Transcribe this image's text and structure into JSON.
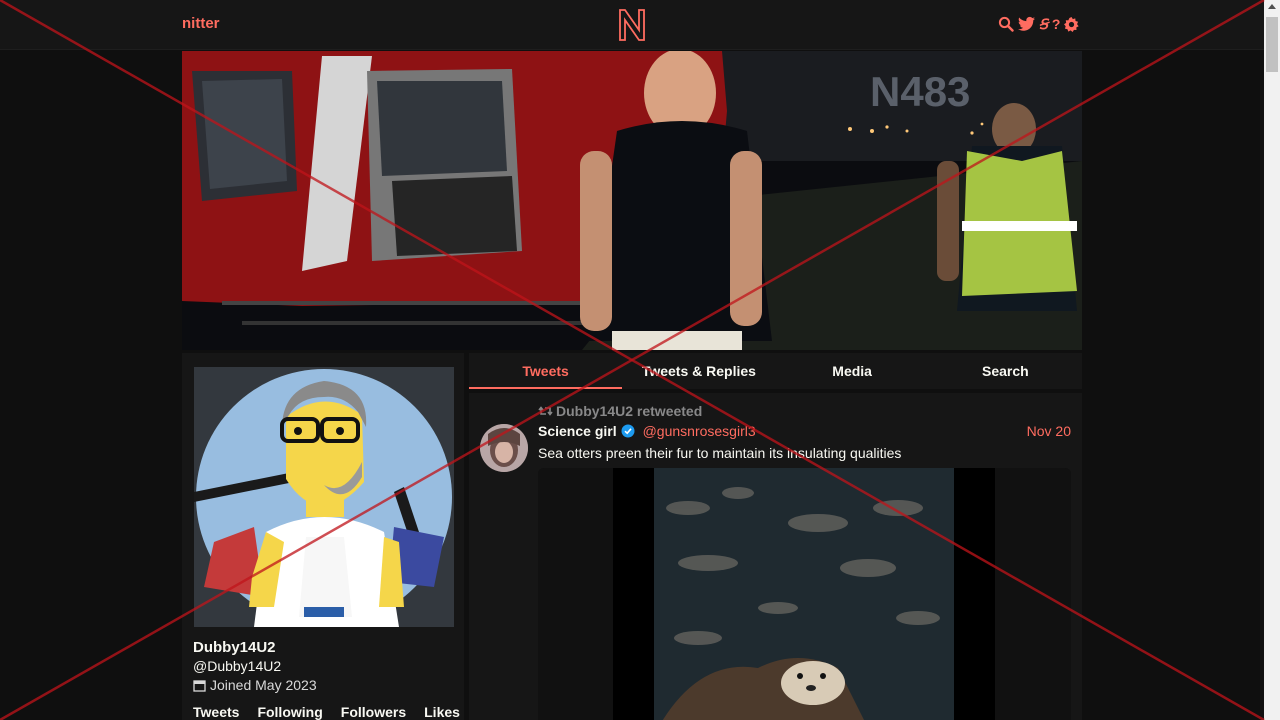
{
  "navbar": {
    "brand": "nitter",
    "icons": [
      "search-icon",
      "twitter-icon",
      "rss-icon",
      "help-icon",
      "settings-icon"
    ],
    "help_label": "?",
    "rss_label": "Ꞩ"
  },
  "colors": {
    "accent": "#ff6c60",
    "background": "#0f0f0f",
    "panel": "#161616",
    "text": "#f8f8f2",
    "muted": "#888889"
  },
  "profile": {
    "fullname": "Dubby14U2",
    "username": "@Dubby14U2",
    "joined": "Joined May 2023",
    "stats": [
      "Tweets",
      "Following",
      "Followers",
      "Likes"
    ]
  },
  "tabs": [
    "Tweets",
    "Tweets & Replies",
    "Media",
    "Search"
  ],
  "active_tab": "Tweets",
  "tweet": {
    "retweet_label": "Dubby14U2 retweeted",
    "author_name": "Science girl",
    "author_handle": "@gunsnrosesgirl3",
    "date": "Nov 20",
    "text": "Sea otters preen their fur to maintain its insulating qualities"
  },
  "banner": {
    "tail_text": "N483"
  }
}
